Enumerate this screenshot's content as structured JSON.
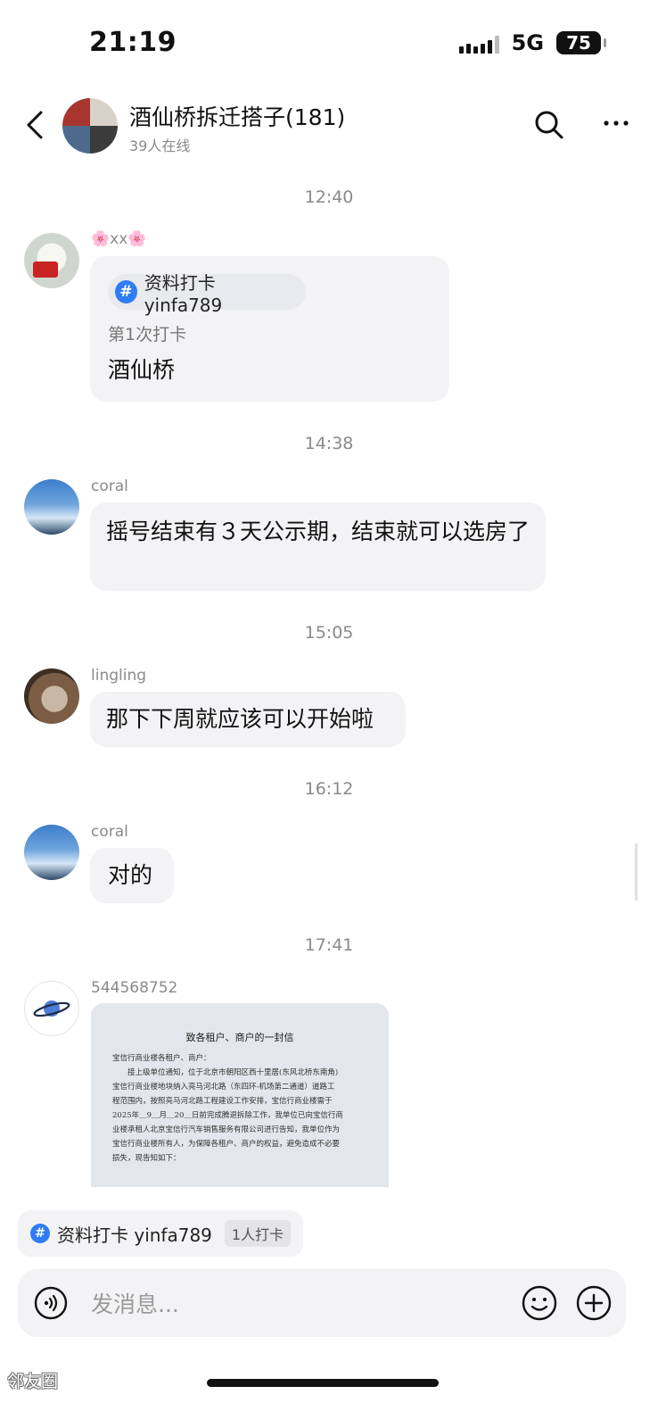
{
  "status_bar": {
    "time": "21:19",
    "network": "5G",
    "battery": "75"
  },
  "header": {
    "title": "酒仙桥拆迁搭子(181)",
    "online": "39人在线"
  },
  "messages": [
    {
      "time": "12:40",
      "sender": "🌸xx🌸",
      "tag": "资料打卡 yinfa789",
      "sub": "第1次打卡",
      "text": "酒仙桥"
    },
    {
      "time": "14:38",
      "sender": "coral",
      "text": "摇号结束有３天公示期，结束就可以选房了"
    },
    {
      "time": "15:05",
      "sender": "lingling",
      "text": "那下下周就应该可以开始啦"
    },
    {
      "time": "16:12",
      "sender": "coral",
      "text": "对的"
    },
    {
      "time": "17:41",
      "sender": "544568752",
      "image": {
        "title": "致各租户、商户的一封信",
        "lines": [
          "宝信行商业楼各租户、商户：",
          "　　接上级单位通知，位于北京市朝阳区西十里居(东风北桥东南角)",
          "宝信行商业楼地块纳入亮马河北路（东四环-机场第二通道）道路工",
          "程范围内，按照亮马河北路工程建设工作安排，宝信行商业楼需于",
          "2025年＿9＿月＿20＿日前完成腾退拆除工作，我单位已向宝信行商",
          "业楼承租人北京宝信行汽车销售服务有限公司进行告知，我单位作为",
          "宝信行商业楼所有人，为保障各租户、商户的权益，避免造成不必要",
          "损失，现告知如下："
        ]
      }
    }
  ],
  "pinned": {
    "label": "资料打卡 yinfa789",
    "badge": "1人打卡"
  },
  "composer": {
    "placeholder": "发消息..."
  },
  "watermark": "邻友圈"
}
